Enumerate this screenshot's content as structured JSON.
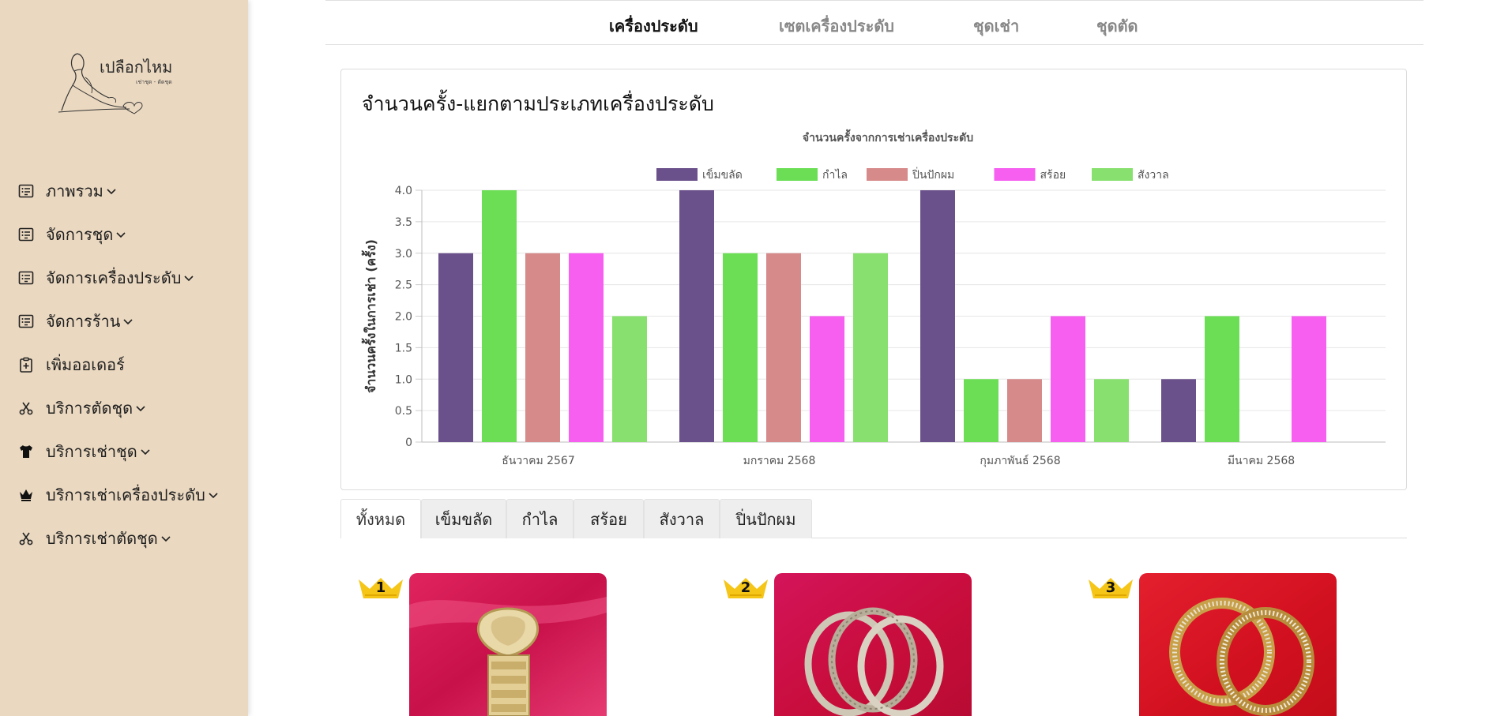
{
  "brand": {
    "logo_text": "เปลือกไหม",
    "logo_subtext": "เช่าชุด - ตัดชุด"
  },
  "sidebar": {
    "items": [
      {
        "label": "ภาพรวม",
        "icon": "list-icon"
      },
      {
        "label": "จัดการชุด",
        "icon": "list-icon"
      },
      {
        "label": "จัดการเครื่องประดับ",
        "icon": "list-icon"
      },
      {
        "label": "จัดการร้าน",
        "icon": "list-icon"
      },
      {
        "label": "เพิ่มออเดอร์",
        "icon": "clipboard-plus-icon"
      },
      {
        "label": "บริการตัดชุด",
        "icon": "scissors-icon"
      },
      {
        "label": "บริการเช่าชุด",
        "icon": "tshirt-icon"
      },
      {
        "label": "บริการเช่าเครื่องประดับ",
        "icon": "crown-icon"
      },
      {
        "label": "บริการเช่าตัดชุด",
        "icon": "scissors-icon"
      }
    ]
  },
  "topnav": {
    "items": [
      "เครื่องประดับ",
      "เซตเครื่องประดับ",
      "ชุดเช่า",
      "ชุดตัด"
    ],
    "active": "เครื่องประดับ"
  },
  "card": {
    "title": "จำนวนครั้ง-แยกตามประเภทเครื่องประดับ"
  },
  "chart_data": {
    "type": "bar",
    "title": "จำนวนครั้งจากการเช่าเครื่องประดับ",
    "ylabel": "จำนวนครั้งในการเช่า (ครั้ง)",
    "xlabel": "",
    "ylim": [
      0,
      4
    ],
    "yticks": [
      "0",
      "0.5",
      "1.0",
      "1.5",
      "2.0",
      "2.5",
      "3.0",
      "3.5",
      "4.0"
    ],
    "grid": true,
    "legend_position": "top",
    "categories": [
      "ธันวาคม 2567",
      "มกราคม 2568",
      "กุมภาพันธ์ 2568",
      "มีนาคม 2568"
    ],
    "series": [
      {
        "name": "เข็มขลัด",
        "color": "#6b518b",
        "values": [
          3,
          4,
          4,
          1
        ]
      },
      {
        "name": "กำไล",
        "color": "#6bde55",
        "values": [
          4,
          3,
          1,
          2
        ]
      },
      {
        "name": "ปิ่นปักผม",
        "color": "#d68a8a",
        "values": [
          3,
          3,
          1,
          0
        ]
      },
      {
        "name": "สร้อย",
        "color": "#f65ff0",
        "values": [
          3,
          2,
          2,
          2
        ]
      },
      {
        "name": "สังวาล",
        "color": "#88e06f",
        "values": [
          2,
          3,
          1,
          0
        ]
      }
    ]
  },
  "filter_tabs": {
    "items": [
      "ทั้งหมด",
      "เข็มขลัด",
      "กำไล",
      "สร้อย",
      "สังวาล",
      "ปิ่นปักผม"
    ],
    "active": "ทั้งหมด"
  },
  "products": [
    {
      "rank": "1",
      "image": "belt-jewelry-on-pink-cloth"
    },
    {
      "rank": "2",
      "image": "bangles-on-pink-cloth"
    },
    {
      "rank": "3",
      "image": "gold-bangles-on-red-cloth"
    }
  ],
  "colors": {
    "sidebar_bg": "#ead8c0",
    "rank_badge": "#f5c518"
  }
}
